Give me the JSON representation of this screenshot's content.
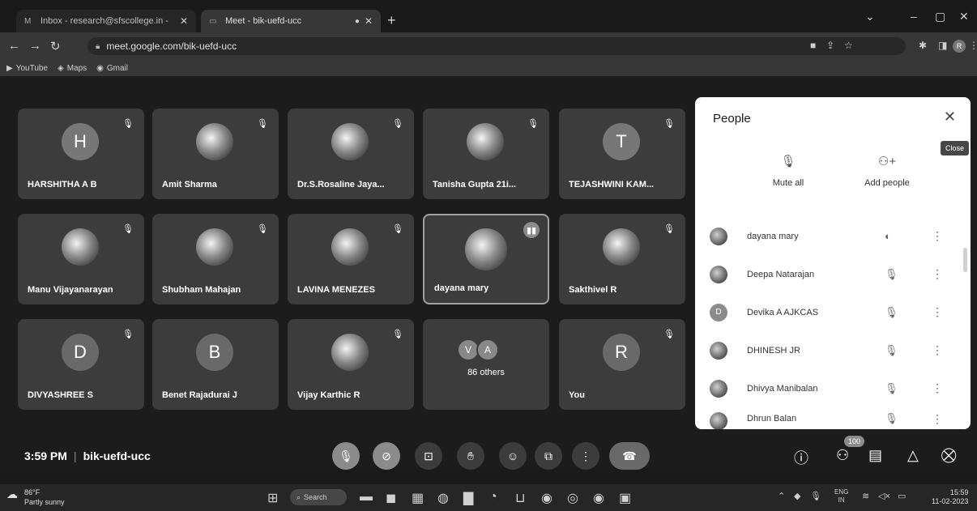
{
  "browser": {
    "tabs": [
      {
        "icon": "gmail-icon",
        "title": "Inbox - research@sfscollege.in - ",
        "close": "✕"
      },
      {
        "icon": "meet-icon",
        "title": "Meet - bik-uefd-ucc",
        "close": "✕"
      }
    ],
    "new_tab": "+",
    "url": "meet.google.com/bik-uefd-ucc",
    "bookmarks": [
      {
        "icon": "youtube-icon",
        "label": "YouTube"
      },
      {
        "icon": "maps-icon",
        "label": "Maps"
      },
      {
        "icon": "gmail-icon",
        "label": "Gmail"
      }
    ],
    "profile_initial": "R"
  },
  "tiles": [
    {
      "name": "HARSHITHA A B",
      "initial": "H",
      "photo": false,
      "muted": true
    },
    {
      "name": "Amit Sharma",
      "initial": "",
      "photo": true,
      "muted": true
    },
    {
      "name": "Dr.S.Rosaline Jaya...",
      "initial": "",
      "photo": true,
      "muted": true
    },
    {
      "name": "Tanisha Gupta 21i...",
      "initial": "",
      "photo": true,
      "muted": true
    },
    {
      "name": "TEJASHWINI KAM...",
      "initial": "T",
      "photo": false,
      "muted": true
    },
    {
      "name": "Manu Vijayanarayan",
      "initial": "",
      "photo": true,
      "muted": true
    },
    {
      "name": "Shubham Mahajan",
      "initial": "",
      "photo": true,
      "muted": true
    },
    {
      "name": "LAVINA MENEZES",
      "initial": "",
      "photo": true,
      "muted": true
    },
    {
      "name": "dayana mary",
      "initial": "",
      "photo": true,
      "muted": false,
      "speaking": true
    },
    {
      "name": "Sakthivel R",
      "initial": "",
      "photo": true,
      "muted": true
    },
    {
      "name": "DIVYASHREE S",
      "initial": "D",
      "photo": false,
      "muted": true
    },
    {
      "name": "Benet Rajadurai J",
      "initial": "B",
      "photo": false,
      "muted": false
    },
    {
      "name": "Vijay Karthic R",
      "initial": "",
      "photo": true,
      "muted": true
    },
    {
      "name": "",
      "initial": "",
      "photo": false,
      "muted": false,
      "others": true
    },
    {
      "name": "You",
      "initial": "R",
      "photo": false,
      "muted": true
    }
  ],
  "others": {
    "initials": [
      "V",
      "A"
    ],
    "label": "86 others"
  },
  "people_panel": {
    "title": "People",
    "close_tooltip": "Close",
    "mute_all": "Mute all",
    "add_people": "Add people",
    "participants": [
      {
        "name": "dayana mary",
        "avatar": "",
        "status": "speaking"
      },
      {
        "name": "Deepa Natarajan",
        "avatar": "",
        "status": "muted"
      },
      {
        "name": "Devika A AJKCAS",
        "avatar": "D",
        "status": "muted"
      },
      {
        "name": "DHINESH JR",
        "avatar": "",
        "status": "muted"
      },
      {
        "name": "Dhivya Manibalan",
        "avatar": "",
        "status": "muted"
      },
      {
        "name": "Dhrun Balan",
        "avatar": "",
        "status": "muted"
      }
    ]
  },
  "meeting": {
    "time": "3:59 PM",
    "code": "bik-uefd-ucc",
    "participant_count": "100"
  },
  "taskbar": {
    "weather_temp": "86°F",
    "weather_desc": "Partly sunny",
    "search": "Search",
    "lang_top": "ENG",
    "lang_bottom": "IN",
    "clock_time": "15:59",
    "clock_date": "11-02-2023"
  }
}
